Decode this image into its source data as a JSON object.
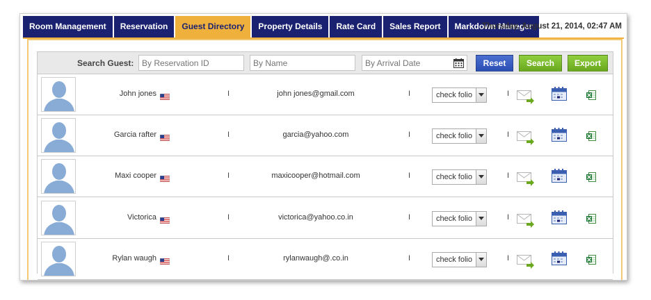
{
  "nav": {
    "tabs": [
      {
        "label": "Room Management"
      },
      {
        "label": "Reservation"
      },
      {
        "label": "Guest Directory"
      },
      {
        "label": "Property Details"
      },
      {
        "label": "Rate Card"
      },
      {
        "label": "Sales Report"
      },
      {
        "label": "Markdown Manager"
      }
    ],
    "active_tab": "Guest Directory",
    "datetime": "Thursday, August 21, 2014, 02:47 AM"
  },
  "search": {
    "label": "Search Guest:",
    "reservation_id_placeholder": "By Reservation ID",
    "name_placeholder": "By Name",
    "arrival_date_placeholder": "By Arrival Date",
    "reset_label": "Reset",
    "search_label": "Search",
    "export_label": "Export"
  },
  "separator": "I",
  "guests": [
    {
      "name": "John jones",
      "email": "john jones@gmail.com",
      "folio": "check folio"
    },
    {
      "name": "Garcia rafter",
      "email": "garcia@yahoo.com",
      "folio": "check folio"
    },
    {
      "name": "Maxi cooper",
      "email": "maxicooper@hotmail.com",
      "folio": "check folio"
    },
    {
      "name": "Victorica",
      "email": "victorica@yahoo.co.in",
      "folio": "check folio"
    },
    {
      "name": "Rylan waugh",
      "email": "rylanwaugh@.co.in",
      "folio": "check folio"
    }
  ],
  "icons": {
    "avatar": "user-silhouette-icon",
    "flag": "us-flag-icon",
    "email_action": "send-email-icon",
    "calendar_action": "calendar-icon",
    "excel_action": "excel-export-icon"
  },
  "colors": {
    "tab_bg": "#1a2170",
    "tab_active_bg": "#f0b13c",
    "reset_button": "#2b4eb3",
    "search_button": "#6aa820",
    "avatar_blue": "#89acd6"
  }
}
